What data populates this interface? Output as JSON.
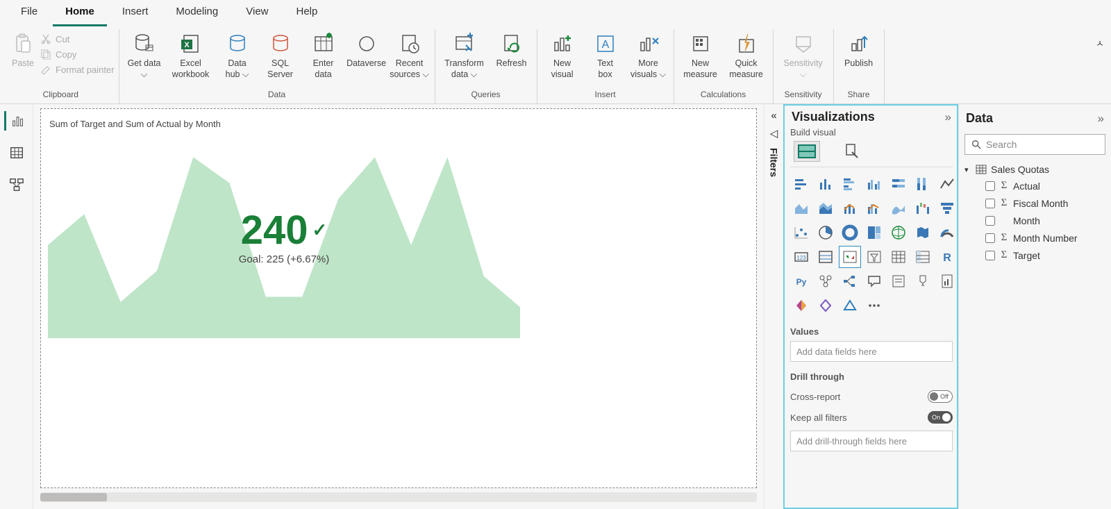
{
  "top_menu": [
    "File",
    "Home",
    "Insert",
    "Modeling",
    "View",
    "Help"
  ],
  "active_tab": "Home",
  "ribbon": {
    "paste": "Paste",
    "cut": "Cut",
    "copy": "Copy",
    "format_painter": "Format painter",
    "get_data": "Get data",
    "excel": "Excel workbook",
    "data_hub": "Data hub",
    "sql": "SQL Server",
    "enter_data": "Enter data",
    "dataverse": "Dataverse",
    "recent": "Recent sources",
    "transform": "Transform data",
    "refresh": "Refresh",
    "new_visual": "New visual",
    "text_box": "Text box",
    "more_visuals": "More visuals",
    "new_measure": "New measure",
    "quick_measure": "Quick measure",
    "sensitivity": "Sensitivity",
    "publish": "Publish",
    "groups": {
      "clipboard": "Clipboard",
      "data": "Data",
      "queries": "Queries",
      "insert": "Insert",
      "calculations": "Calculations",
      "sensitivity": "Sensitivity",
      "share": "Share"
    }
  },
  "filters_label": "Filters",
  "viz_pane": {
    "title": "Visualizations",
    "sub": "Build visual",
    "values_label": "Values",
    "values_placeholder": "Add data fields here",
    "drill_label": "Drill through",
    "cross_report": "Cross-report",
    "cross_report_state": "Off",
    "keep_filters": "Keep all filters",
    "keep_filters_state": "On",
    "drill_placeholder": "Add drill-through fields here"
  },
  "data_pane": {
    "title": "Data",
    "search": "Search",
    "table": "Sales Quotas",
    "fields": [
      {
        "name": "Actual",
        "numeric": true
      },
      {
        "name": "Fiscal Month",
        "numeric": true
      },
      {
        "name": "Month",
        "numeric": false
      },
      {
        "name": "Month Number",
        "numeric": true
      },
      {
        "name": "Target",
        "numeric": true
      }
    ]
  },
  "kpi": {
    "title": "Sum of Target and Sum of Actual by Month",
    "value": "240",
    "goal_line": "Goal: 225 (+6.67%)"
  },
  "chart_data": {
    "type": "area",
    "title": "Sum of Target and Sum of Actual by Month",
    "kpi_value": 240,
    "goal_value": 225,
    "goal_pct_change": 6.67,
    "x": [
      0,
      1,
      2,
      3,
      4,
      5,
      6,
      7,
      8,
      9,
      10,
      11,
      12,
      13
    ],
    "y": [
      180,
      240,
      70,
      130,
      350,
      300,
      80,
      80,
      270,
      350,
      180,
      350,
      120,
      60
    ],
    "ylim": [
      0,
      400
    ],
    "fill_color": "#bfe5c9"
  }
}
